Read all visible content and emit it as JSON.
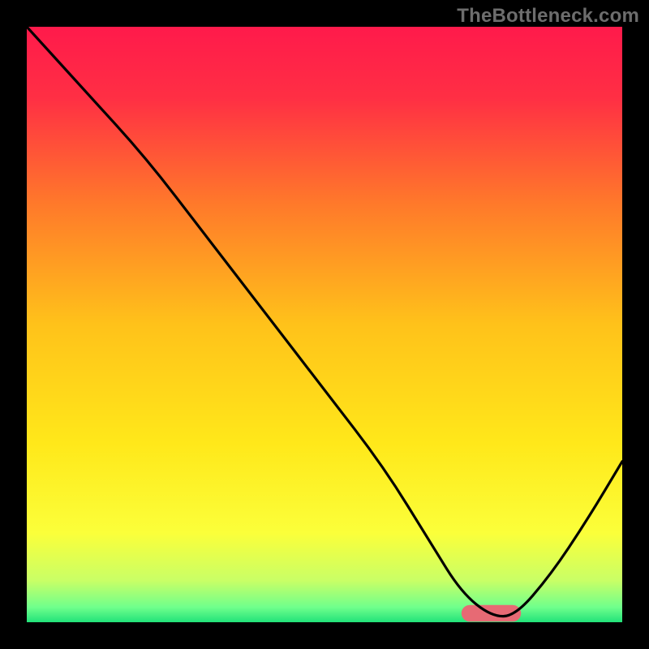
{
  "watermark": "TheBottleneck.com",
  "chart_data": {
    "type": "line",
    "title": "",
    "xlabel": "",
    "ylabel": "",
    "xlim": [
      0,
      100
    ],
    "ylim": [
      0,
      100
    ],
    "background_gradient": {
      "stops": [
        {
          "pos": 0.0,
          "color": "#ff1a4b"
        },
        {
          "pos": 0.12,
          "color": "#ff2f44"
        },
        {
          "pos": 0.3,
          "color": "#ff7a2a"
        },
        {
          "pos": 0.5,
          "color": "#ffc21a"
        },
        {
          "pos": 0.7,
          "color": "#ffe81a"
        },
        {
          "pos": 0.85,
          "color": "#fbff3a"
        },
        {
          "pos": 0.93,
          "color": "#c9ff66"
        },
        {
          "pos": 0.975,
          "color": "#6fff8c"
        },
        {
          "pos": 1.0,
          "color": "#22e27a"
        }
      ]
    },
    "series": [
      {
        "name": "bottleneck-curve",
        "color": "#000000",
        "width": 3.2,
        "x": [
          0,
          10,
          20,
          30,
          40,
          50,
          60,
          68,
          73,
          78,
          82,
          88,
          94,
          100
        ],
        "y": [
          100,
          89,
          78,
          65,
          52,
          39,
          26,
          13,
          5,
          1,
          1,
          8,
          17,
          27
        ]
      }
    ],
    "marker": {
      "name": "optimal-range",
      "shape": "capsule",
      "x_center": 78,
      "y_center": 1.5,
      "width": 10,
      "height": 2.8,
      "fill": "#e76a74"
    }
  }
}
